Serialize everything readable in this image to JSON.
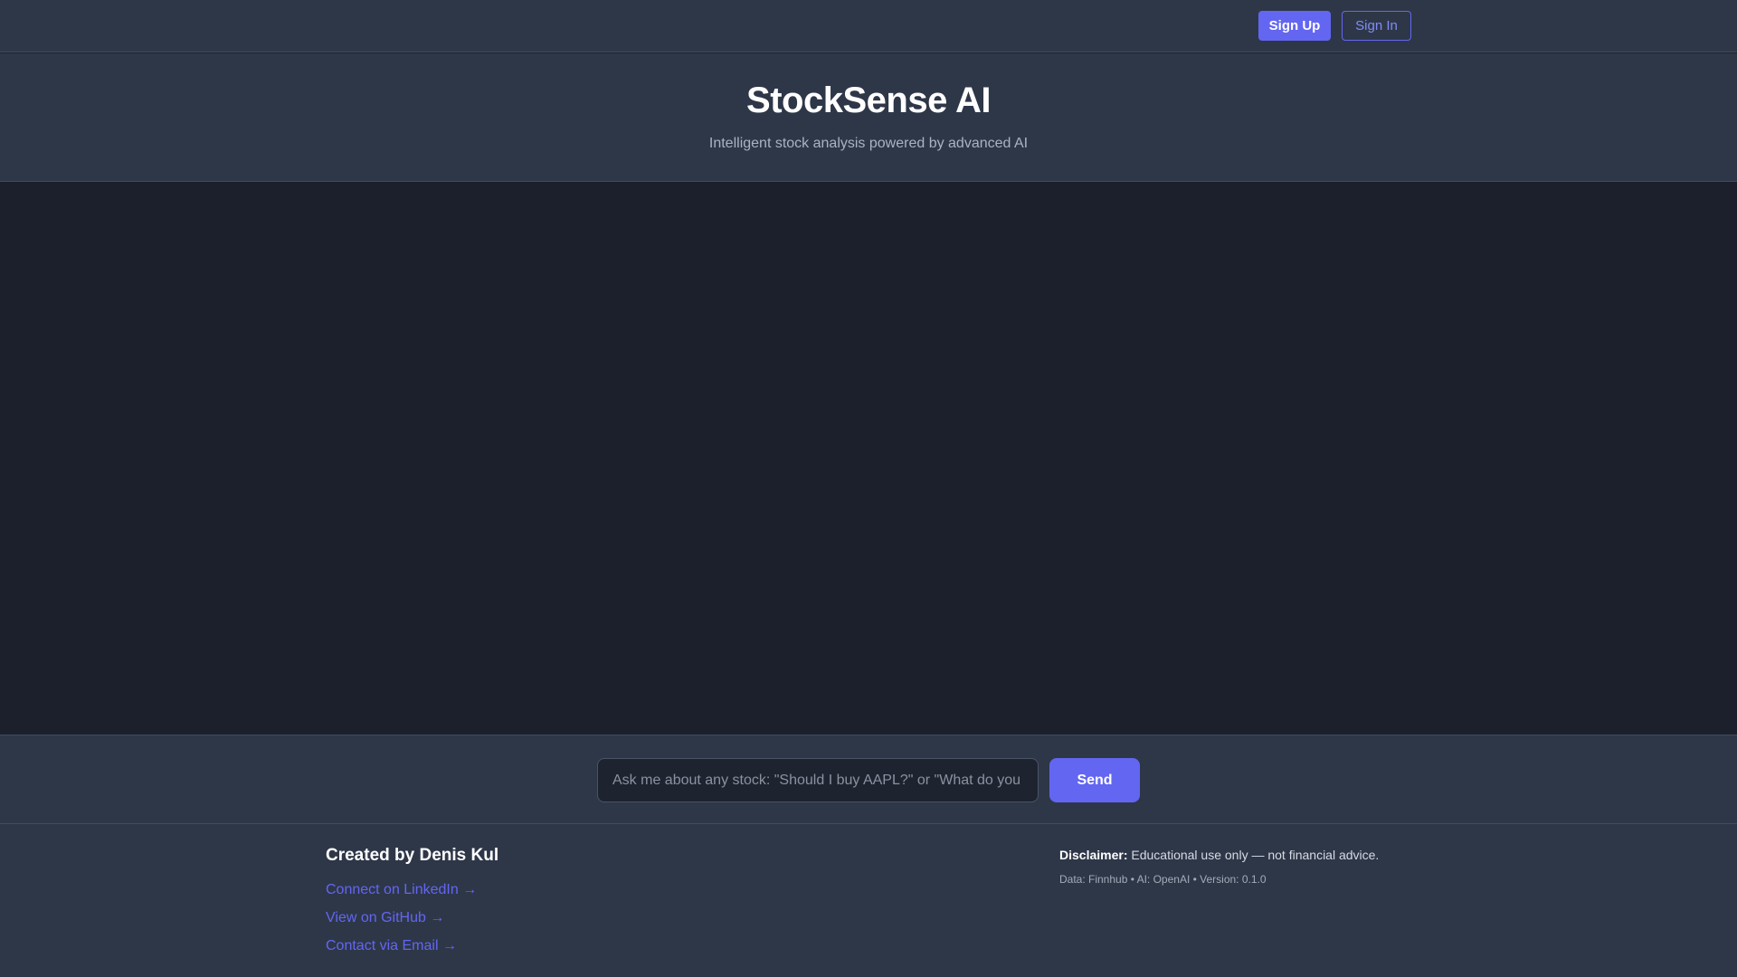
{
  "topbar": {
    "signup_label": "Sign Up",
    "signin_label": "Sign In"
  },
  "hero": {
    "title": "StockSense AI",
    "subtitle": "Intelligent stock analysis powered by advanced AI"
  },
  "chat": {
    "placeholder": "Ask me about any stock: \"Should I buy AAPL?\" or \"What do you think about Tesla?\"",
    "send_label": "Send"
  },
  "footer": {
    "heading": "Created by Denis Kul",
    "links": [
      "Connect on LinkedIn →",
      "View on GitHub →",
      "Contact via Email →"
    ],
    "disclaimer_label": "Disclaimer:",
    "disclaimer_text": " Educational use only — not financial advice.",
    "meta": "Data: Finnhub • AI: OpenAI • Version: 0.1.0"
  },
  "colors": {
    "accent": "#6366f1",
    "panel": "#2e3748",
    "background": "#1b202c"
  }
}
